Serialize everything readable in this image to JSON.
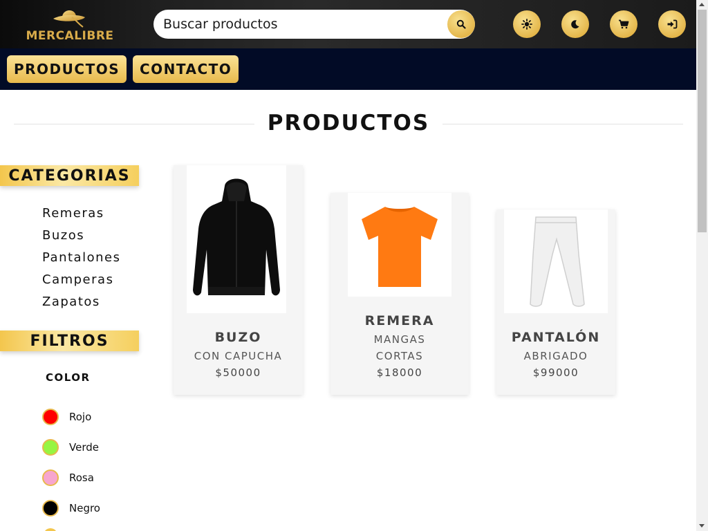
{
  "header": {
    "logo_text": "MERCALIBRE",
    "search_placeholder": "Buscar productos",
    "icons": [
      "search-icon",
      "sun-icon",
      "moon-icon",
      "cart-icon",
      "login-icon"
    ],
    "accent_color": "#e8b94c"
  },
  "nav": {
    "items": [
      {
        "label": "PRODUCTOS"
      },
      {
        "label": "CONTACTO"
      }
    ]
  },
  "main": {
    "title": "PRODUCTOS"
  },
  "sidebar": {
    "categories_heading": "CATEGORIAS",
    "categories": [
      "Remeras",
      "Buzos",
      "Pantalones",
      "Camperas",
      "Zapatos"
    ],
    "filters_heading": "FILTROS",
    "color_label": "COLOR",
    "colors": [
      {
        "name": "Rojo",
        "hex": "#ff0000"
      },
      {
        "name": "Verde",
        "hex": "#96f542"
      },
      {
        "name": "Rosa",
        "hex": "#f7a6cf"
      },
      {
        "name": "Negro",
        "hex": "#000000"
      }
    ]
  },
  "products": [
    {
      "name": "BUZO",
      "desc": "CON CAPUCHA",
      "price": "$50000",
      "image": "black-hoodie"
    },
    {
      "name": "REMERA",
      "desc": "MANGAS CORTAS",
      "price": "$18000",
      "image": "orange-tshirt"
    },
    {
      "name": "PANTALÓN",
      "desc": "ABRIGADO",
      "price": "$99000",
      "image": "white-pants"
    }
  ]
}
